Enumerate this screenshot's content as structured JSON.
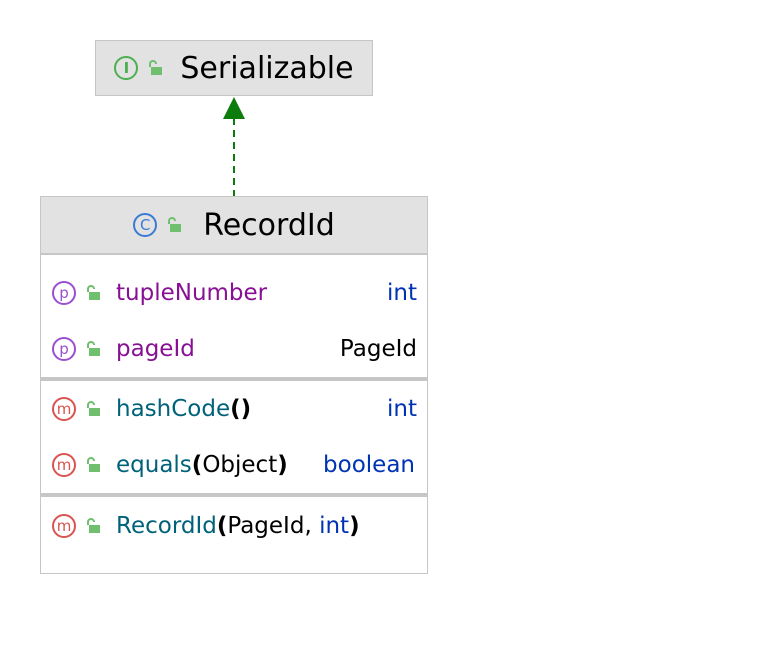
{
  "interface": {
    "name": "Serializable",
    "badge": "I"
  },
  "class": {
    "name": "RecordId",
    "badge": "C",
    "fields": [
      {
        "badge": "p",
        "name": "tupleNumber",
        "type": "int"
      },
      {
        "badge": "p",
        "name": "pageId",
        "type": "PageId"
      }
    ],
    "methods": [
      {
        "badge": "m",
        "name": "hashCode",
        "params": "",
        "type": "int"
      },
      {
        "badge": "m",
        "name": "equals",
        "params": "Object",
        "type": "boolean"
      }
    ],
    "constructors": [
      {
        "badge": "m",
        "name": "RecordId",
        "param1": "PageId",
        "sep": ", ",
        "param2": "int"
      }
    ]
  },
  "colors": {
    "arrow": "#0c7d0c",
    "header_bg": "#e2e2e2",
    "border": "#c6c6c6"
  },
  "icons": {
    "interface": "interface-icon",
    "class": "class-icon",
    "property": "property-icon",
    "method": "method-icon",
    "visibility": "unlocked-public-icon"
  }
}
